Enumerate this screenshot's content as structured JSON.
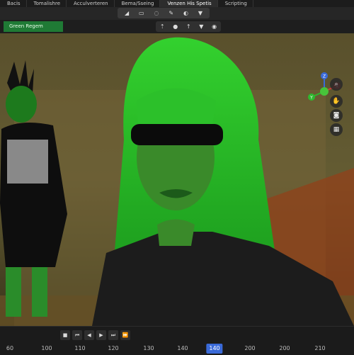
{
  "tabs": [
    {
      "label": "Bacis",
      "active": false
    },
    {
      "label": "Tomalishre",
      "active": false
    },
    {
      "label": "Acculverteren",
      "active": false
    },
    {
      "label": "Bema/Sseing",
      "active": false
    },
    {
      "label": "Venzen His Spetis",
      "active": true
    },
    {
      "label": "Scripting",
      "active": false
    }
  ],
  "layer_field": {
    "value": "Green Regem"
  },
  "toolbar_icons": [
    "view-mode-icon",
    "select-icon",
    "lasso-icon",
    "brush-icon",
    "shading-icon",
    "filter-icon"
  ],
  "overlay_icons": [
    "cursor-icon",
    "sphere-icon",
    "arrow-icon",
    "filter-icon",
    "globe-icon"
  ],
  "nav_icons": [
    "zoom-icon",
    "hand-icon",
    "camera-icon",
    "grid-icon"
  ],
  "gizmo_axes": [
    "X",
    "Y",
    "Z"
  ],
  "transport_buttons": [
    "jump-start",
    "prev-key",
    "play-reverse",
    "play",
    "next-key",
    "jump-end"
  ],
  "timeline": {
    "ticks": [
      "60",
      "100",
      "110",
      "120",
      "130",
      "140",
      "140",
      "200",
      "200",
      "210"
    ],
    "current_frame": "140"
  },
  "colors": {
    "accent": "#3a6ad8",
    "layer_green": "#1f7a35",
    "tint": "#1ca82a"
  }
}
